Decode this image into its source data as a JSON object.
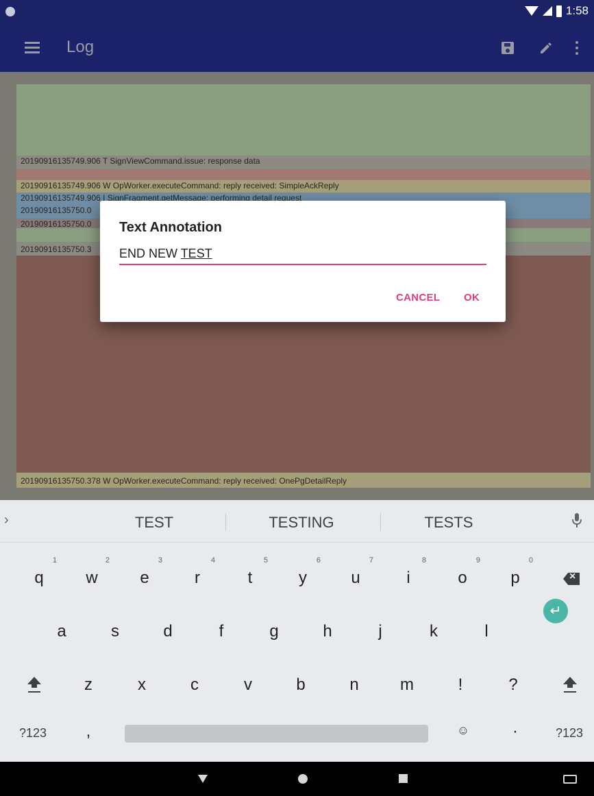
{
  "status_bar": {
    "time": "1:58"
  },
  "app_bar": {
    "title": "Log"
  },
  "log": {
    "lines": [
      "20190916135749.906 T SignViewCommand.issue: response data",
      "20190916135749.906 W OpWorker.executeCommand: reply received: SimpleAckReply",
      "20190916135749.906 I SignFragment.getMessage: performing detail request",
      "20190916135750.0",
      "20190916135750.0",
      "20190916135750.3",
      "20190916135750.378 W OpWorker.executeCommand: reply received: OnePgDetailReply"
    ]
  },
  "dialog": {
    "title": "Text Annotation",
    "input_prefix": "END NEW ",
    "input_underlined": "TEST",
    "cancel_label": "CANCEL",
    "ok_label": "OK",
    "accent_color": "#e33b7f"
  },
  "keyboard": {
    "suggestions": [
      "TEST",
      "TESTING",
      "TESTS"
    ],
    "row1": [
      {
        "k": "q",
        "n": "1"
      },
      {
        "k": "w",
        "n": "2"
      },
      {
        "k": "e",
        "n": "3"
      },
      {
        "k": "r",
        "n": "4"
      },
      {
        "k": "t",
        "n": "5"
      },
      {
        "k": "y",
        "n": "6"
      },
      {
        "k": "u",
        "n": "7"
      },
      {
        "k": "i",
        "n": "8"
      },
      {
        "k": "o",
        "n": "9"
      },
      {
        "k": "p",
        "n": "0"
      }
    ],
    "row2": [
      "a",
      "s",
      "d",
      "f",
      "g",
      "h",
      "j",
      "k",
      "l"
    ],
    "row3": [
      "z",
      "x",
      "c",
      "v",
      "b",
      "n",
      "m",
      "!",
      "?"
    ],
    "symbols_label": "?123",
    "comma_label": ",",
    "period_label": "·",
    "enter_color": "#4bb6a7"
  },
  "icons": [
    "menu-icon",
    "save-icon",
    "edit-icon",
    "more-icon",
    "mic-icon",
    "backspace-icon",
    "enter-icon",
    "shift-icon",
    "emoji-icon"
  ]
}
